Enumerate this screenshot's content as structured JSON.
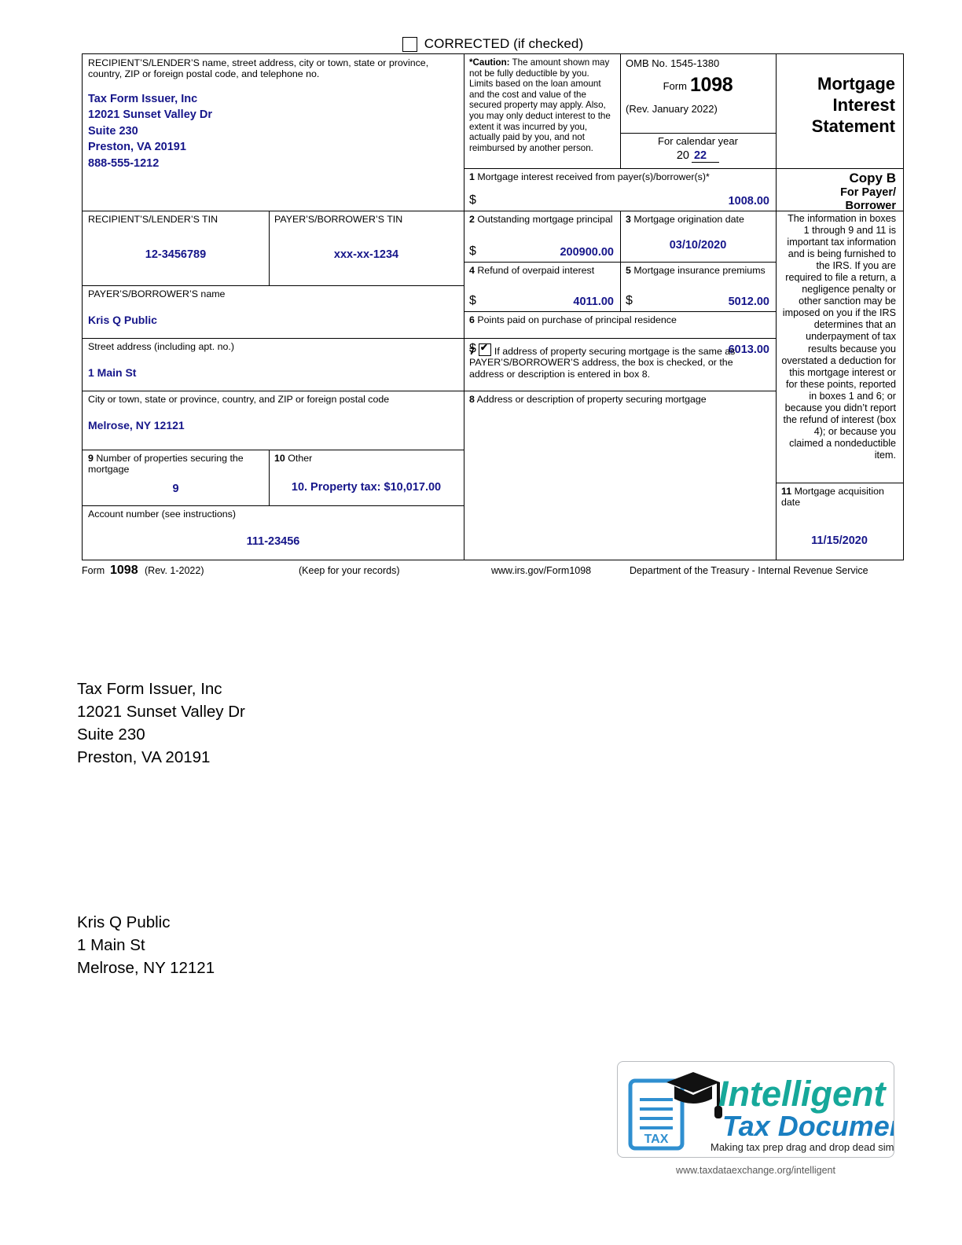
{
  "header": {
    "corrected_label": "CORRECTED (if checked)",
    "corrected_checked": false
  },
  "form": {
    "lender": {
      "caption": "RECIPIENT’S/LENDER’S name, street address, city or town, state or province, country, ZIP or foreign postal code, and telephone no.",
      "name": "Tax Form Issuer, Inc",
      "street": "12021 Sunset Valley Dr",
      "suite": "Suite 230",
      "citystatezip": "Preston, VA 20191",
      "phone": "888-555-1212"
    },
    "caution": {
      "bold_lead": "*Caution:",
      "text": " The amount shown may not be fully deductible by you. Limits based on the loan amount and the cost and value of the secured property may apply. Also, you may only deduct interest to the extent it was incurred by you, actually paid by you, and not reimbursed by another person."
    },
    "omb": {
      "number": "OMB No. 1545-1380",
      "form_word": "Form",
      "form_number": "1098",
      "revision": "(Rev. January 2022)"
    },
    "calendar_year": {
      "caption": "For calendar year",
      "prefix": "20",
      "year": "22"
    },
    "title": {
      "line1": "Mortgage",
      "line2": "Interest",
      "line3": "Statement"
    },
    "copy_b": {
      "heading": "Copy B",
      "subheading_line1": "For Payer/",
      "subheading_line2": "Borrower",
      "body": "The information in boxes 1 through 9 and 11 is important tax information and is being furnished to the IRS. If you are required to file a return, a negligence penalty or other sanction may be imposed on you if the IRS determines that an underpayment of tax results because you overstated a deduction for this mortgage interest or for these points, reported in boxes 1 and 6; or because you didn’t report the refund of interest (box 4); or because you claimed a nondeductible item."
    },
    "lender_tin": {
      "caption": "RECIPIENT’S/LENDER’S TIN",
      "value": "12-3456789"
    },
    "payer_tin": {
      "caption": "PAYER’S/BORROWER’S TIN",
      "value": "xxx-xx-1234"
    },
    "payer_name": {
      "caption": "PAYER’S/BORROWER’S name",
      "value": "Kris Q Public"
    },
    "payer_street": {
      "caption": "Street address (including apt. no.)",
      "value": "1 Main St"
    },
    "payer_city": {
      "caption": "City or town, state or province, country, and ZIP or foreign postal code",
      "value": "Melrose, NY 12121"
    },
    "account_number": {
      "caption": "Account number (see instructions)",
      "value": "111-23456"
    },
    "boxes": {
      "box1": {
        "num": "1",
        "caption": "Mortgage interest received from payer(s)/borrower(s)*",
        "dollar": "$",
        "value": "1008.00"
      },
      "box2": {
        "num": "2",
        "caption": "Outstanding mortgage principal",
        "dollar": "$",
        "value": "200900.00"
      },
      "box3": {
        "num": "3",
        "caption": "Mortgage origination date",
        "value": "03/10/2020"
      },
      "box4": {
        "num": "4",
        "caption": "Refund of overpaid interest",
        "dollar": "$",
        "value": "4011.00"
      },
      "box5": {
        "num": "5",
        "caption": "Mortgage insurance premiums",
        "dollar": "$",
        "value": "5012.00"
      },
      "box6": {
        "num": "6",
        "caption": "Points paid on purchase of principal residence",
        "dollar": "$",
        "value": "6013.00"
      },
      "box7": {
        "num": "7",
        "checked": true,
        "caption": "If address of property securing mortgage is the same as PAYER’S/BORROWER’S address, the box is checked, or the address or description is entered in box 8."
      },
      "box8": {
        "num": "8",
        "caption": "Address or description of property securing mortgage",
        "value": ""
      },
      "box9": {
        "num": "9",
        "caption": "Number of properties securing the mortgage",
        "value": "9"
      },
      "box10": {
        "num": "10",
        "caption": "Other",
        "value": "10. Property tax: $10,017.00"
      },
      "box11": {
        "num": "11",
        "caption": "Mortgage acquisition date",
        "value": "11/15/2020"
      }
    },
    "footer": {
      "form_word": "Form",
      "form_number": "1098",
      "revision": "(Rev. 1-2022)",
      "keep": "(Keep for your records)",
      "url": "www.irs.gov/Form1098",
      "department": "Department of the Treasury - Internal Revenue Service"
    }
  },
  "issuer_mailing": {
    "line1": "Tax Form Issuer, Inc",
    "line2": "12021 Sunset Valley Dr",
    "line3": "Suite 230",
    "line4": "Preston, VA 20191"
  },
  "payer_mailing": {
    "line1": "Kris Q Public",
    "line2": "1 Main St",
    "line3": "Melrose, NY 12121"
  },
  "logo": {
    "word1": "Intelligent",
    "word2": "Tax Document",
    "tagline": "Making tax prep drag and drop dead simple",
    "doc_label": "TAX",
    "url": "www.taxdataexchange.org/intelligent",
    "teal": "#16a89a",
    "blue": "#1a7fc1"
  }
}
